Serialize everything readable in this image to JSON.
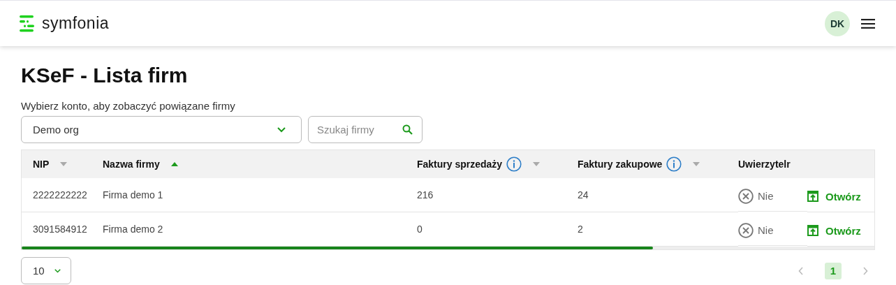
{
  "header": {
    "logo": "symfonia",
    "avatar": "DK"
  },
  "title": "KSeF - Lista firm",
  "account_label": "Wybierz konto, aby zobaczyć powiązane firmy",
  "account_select": {
    "value": "Demo org"
  },
  "search": {
    "placeholder": "Szukaj firmy"
  },
  "table": {
    "columns": [
      {
        "label": "NIP",
        "sortable": true,
        "sorted": false,
        "info": false
      },
      {
        "label": "Nazwa firmy",
        "sortable": true,
        "sorted": true,
        "info": false
      },
      {
        "label": "Faktury sprzedaży",
        "sortable": true,
        "sorted": false,
        "info": true
      },
      {
        "label": "Faktury zakupowe",
        "sortable": true,
        "sorted": false,
        "info": true
      },
      {
        "label": "Uwierzytelr",
        "sortable": false,
        "info": false
      }
    ],
    "rows": [
      {
        "nip": "2222222222",
        "name": "Firma demo 1",
        "sales": "216",
        "purchases": "24",
        "authenticated": false,
        "auth_label": "Nie",
        "action": "Otwórz"
      },
      {
        "nip": "3091584912",
        "name": "Firma demo 2",
        "sales": "0",
        "purchases": "2",
        "authenticated": false,
        "auth_label": "Nie",
        "action": "Otwórz"
      }
    ]
  },
  "page_size": {
    "value": "10"
  },
  "pagination": {
    "pages": [
      {
        "label": "1",
        "selected": true
      }
    ]
  }
}
